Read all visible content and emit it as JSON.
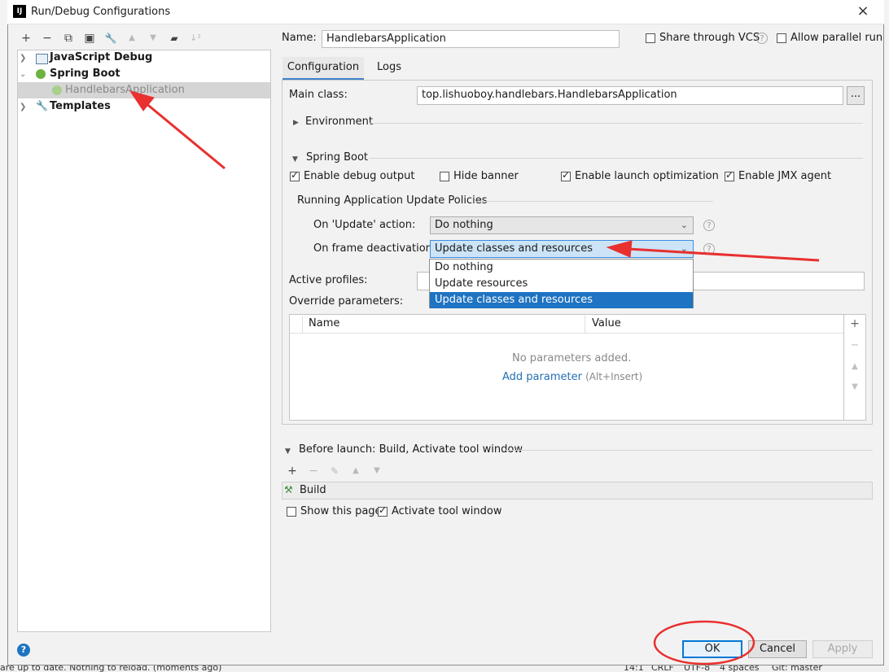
{
  "window": {
    "title": "Run/Debug Configurations",
    "logo": "IJ",
    "close": "×"
  },
  "toolbar": {
    "icons": [
      "plus-icon",
      "minus-icon",
      "copy-icon",
      "save-icon",
      "wrench-icon",
      "arrow-up-icon",
      "arrow-down-icon",
      "folder-icon",
      "sort-icon"
    ],
    "glyphs": [
      "+",
      "−",
      "⧉",
      "▣",
      "🔧",
      "▲",
      "▼",
      "▰",
      "↓²"
    ]
  },
  "tree": {
    "items": [
      {
        "label": "JavaScript Debug"
      },
      {
        "label": "Spring Boot"
      },
      {
        "label": "HandlebarsApplication"
      },
      {
        "label": "Templates"
      }
    ]
  },
  "name_row": {
    "label": "Name:",
    "value": "HandlebarsApplication",
    "share_label": "Share through VCS",
    "parallel_label": "Allow parallel run"
  },
  "tabs": [
    {
      "label": "Configuration"
    },
    {
      "label": "Logs"
    }
  ],
  "config": {
    "main_class_label": "Main class:",
    "main_class_value": "top.lishuoboy.handlebars.HandlebarsApplication",
    "browse": "...",
    "environment_label": "Environment",
    "spring_boot_label": "Spring Boot",
    "checks": [
      {
        "label": "Enable debug output",
        "checked": true
      },
      {
        "label": "Hide banner",
        "checked": false
      },
      {
        "label": "Enable launch optimization",
        "checked": true
      },
      {
        "label": "Enable JMX agent",
        "checked": true
      }
    ],
    "policies_label": "Running Application Update Policies",
    "update_action_label": "On 'Update' action:",
    "update_action_value": "Do nothing",
    "frame_deact_label": "On frame deactivation:",
    "frame_deact_value": "Update classes and resources",
    "dropdown_options": [
      "Do nothing",
      "Update resources",
      "Update classes and resources"
    ],
    "active_profiles_label": "Active profiles:",
    "override_label": "Override parameters:",
    "table_headers": [
      "Name",
      "Value"
    ],
    "empty_text": "No parameters added.",
    "add_param_link": "Add parameter",
    "add_param_hint": "(Alt+Insert)"
  },
  "before_launch": {
    "header": "Before launch: Build, Activate tool window",
    "task": "Build",
    "show_page": "Show this page",
    "activate": "Activate tool window"
  },
  "buttons": {
    "ok": "OK",
    "cancel": "Cancel",
    "apply": "Apply",
    "help": "?"
  },
  "status_bar": {
    "left": "are up to date. Nothing to reload. (moments ago)",
    "position": "14:1",
    "line_sep": "CRLF",
    "encoding": "UTF-8",
    "indent": "4 spaces",
    "git": "Git: master"
  },
  "colors": {
    "accent": "#1e73c2",
    "annotation": "#e8302f"
  }
}
